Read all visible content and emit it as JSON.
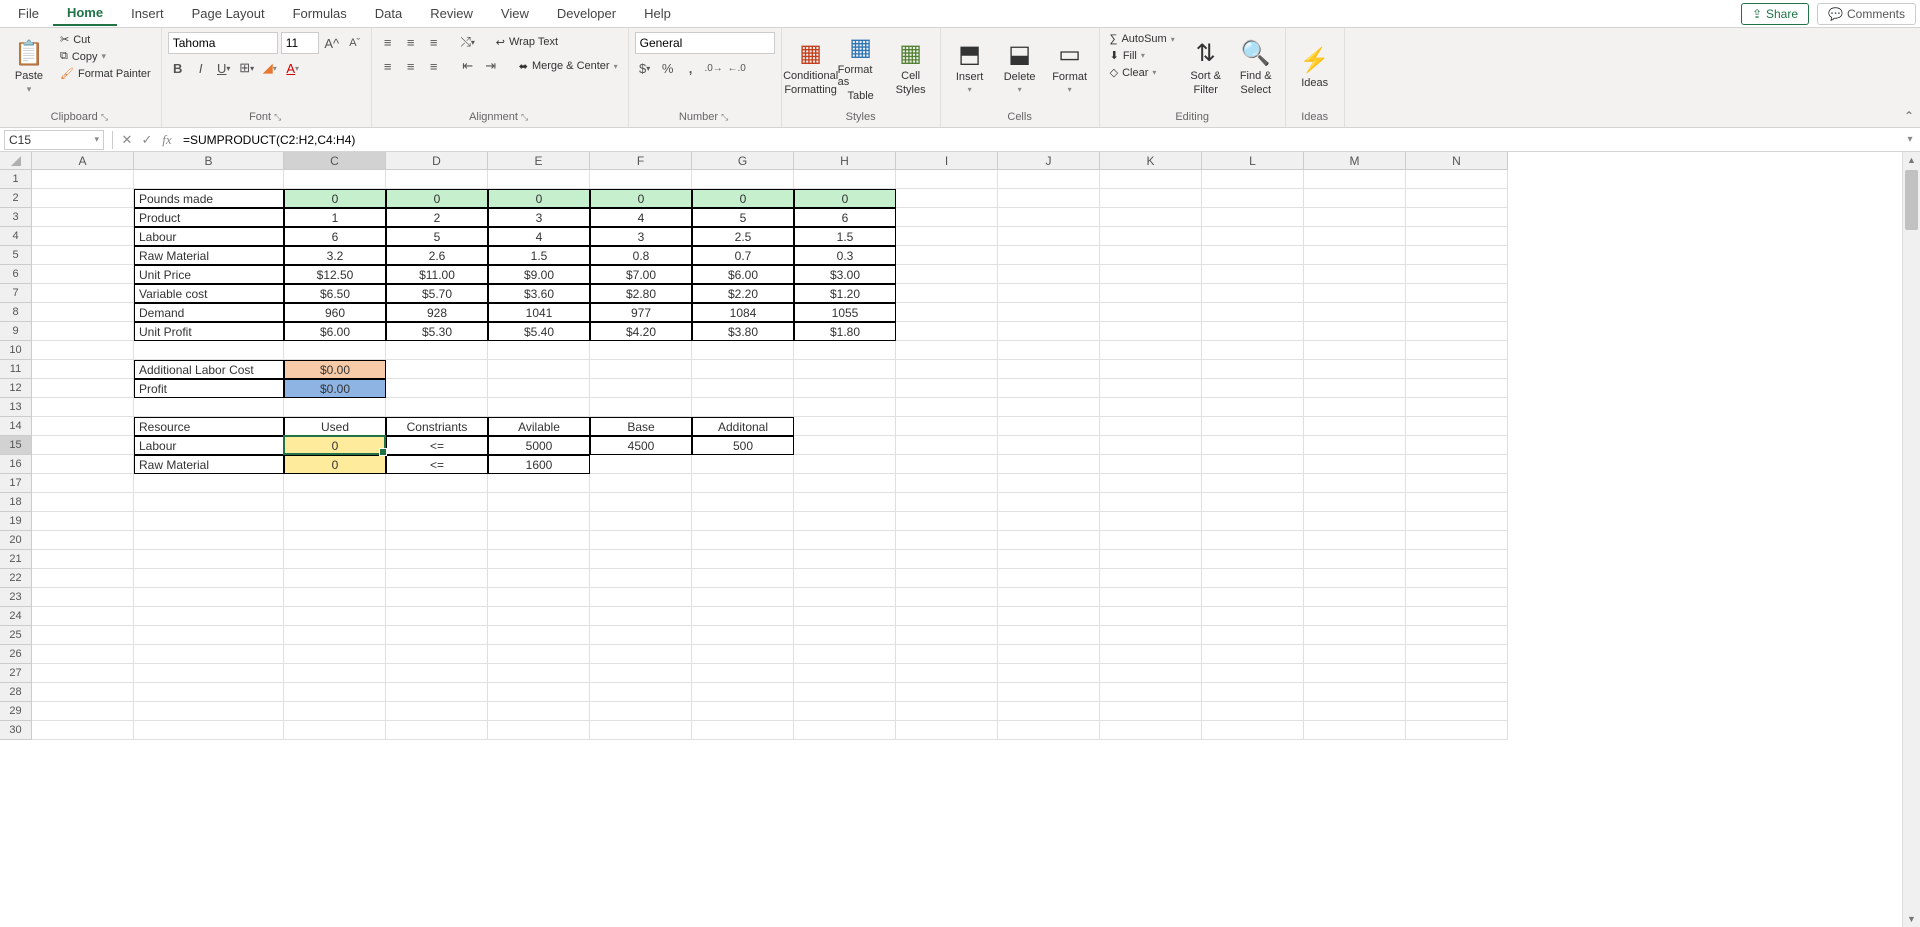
{
  "tabs": [
    "File",
    "Home",
    "Insert",
    "Page Layout",
    "Formulas",
    "Data",
    "Review",
    "View",
    "Developer",
    "Help"
  ],
  "active_tab": 1,
  "share": "Share",
  "comments": "Comments",
  "clipboard": {
    "paste": "Paste",
    "cut": "Cut",
    "copy": "Copy",
    "fmt": "Format Painter",
    "label": "Clipboard"
  },
  "font": {
    "name": "Tahoma",
    "size": "11",
    "label": "Font"
  },
  "alignment": {
    "wrap": "Wrap Text",
    "merge": "Merge & Center",
    "label": "Alignment"
  },
  "number": {
    "format": "General",
    "label": "Number"
  },
  "styles": {
    "cond1": "Conditional",
    "cond2": "Formatting",
    "fat1": "Format as",
    "fat2": "Table",
    "cs1": "Cell",
    "cs2": "Styles",
    "label": "Styles"
  },
  "cellsgrp": {
    "insert": "Insert",
    "delete": "Delete",
    "format": "Format",
    "label": "Cells"
  },
  "editing": {
    "autosum": "AutoSum",
    "fill": "Fill",
    "clear": "Clear",
    "sort1": "Sort &",
    "sort2": "Filter",
    "find1": "Find &",
    "find2": "Select",
    "label": "Editing"
  },
  "ideas": {
    "label": "Ideas",
    "btn": "Ideas"
  },
  "namebox": "C15",
  "formula": "=SUMPRODUCT(C2:H2,C4:H4)",
  "cols": [
    "A",
    "B",
    "C",
    "D",
    "E",
    "F",
    "G",
    "H",
    "I",
    "J",
    "K",
    "L",
    "M",
    "N"
  ],
  "rows": {
    "r2": {
      "b": "Pounds made",
      "c": "0",
      "d": "0",
      "e": "0",
      "f": "0",
      "g": "0",
      "h": "0"
    },
    "r3": {
      "b": "Product",
      "c": "1",
      "d": "2",
      "e": "3",
      "f": "4",
      "g": "5",
      "h": "6"
    },
    "r4": {
      "b": "Labour",
      "c": "6",
      "d": "5",
      "e": "4",
      "f": "3",
      "g": "2.5",
      "h": "1.5"
    },
    "r5": {
      "b": "Raw Material",
      "c": "3.2",
      "d": "2.6",
      "e": "1.5",
      "f": "0.8",
      "g": "0.7",
      "h": "0.3"
    },
    "r6": {
      "b": "Unit Price",
      "c": "$12.50",
      "d": "$11.00",
      "e": "$9.00",
      "f": "$7.00",
      "g": "$6.00",
      "h": "$3.00"
    },
    "r7": {
      "b": "Variable cost",
      "c": "$6.50",
      "d": "$5.70",
      "e": "$3.60",
      "f": "$2.80",
      "g": "$2.20",
      "h": "$1.20"
    },
    "r8": {
      "b": "Demand",
      "c": "960",
      "d": "928",
      "e": "1041",
      "f": "977",
      "g": "1084",
      "h": "1055"
    },
    "r9": {
      "b": "Unit Profit",
      "c": "$6.00",
      "d": "$5.30",
      "e": "$5.40",
      "f": "$4.20",
      "g": "$3.80",
      "h": "$1.80"
    },
    "r11": {
      "b": "Additional Labor Cost",
      "c": "$0.00"
    },
    "r12": {
      "b": "Profit",
      "c": "$0.00"
    },
    "r14": {
      "b": "Resource",
      "c": "Used",
      "d": "Constriants",
      "e": "Avilable",
      "f": "Base",
      "g": "Additonal"
    },
    "r15": {
      "b": "Labour",
      "c": "0",
      "d": "<=",
      "e": "5000",
      "f": "4500",
      "g": "500"
    },
    "r16": {
      "b": "Raw Material",
      "c": "0",
      "d": "<=",
      "e": "1600"
    }
  }
}
